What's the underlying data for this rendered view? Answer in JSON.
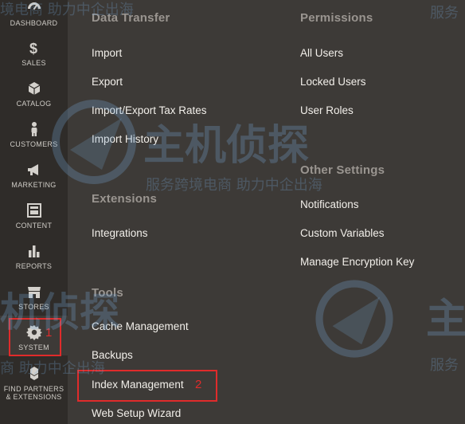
{
  "sidebar": {
    "items": [
      {
        "label": "DASHBOARD",
        "icon": "dashboard-icon"
      },
      {
        "label": "SALES",
        "icon": "dollar-icon"
      },
      {
        "label": "CATALOG",
        "icon": "box-icon"
      },
      {
        "label": "CUSTOMERS",
        "icon": "person-icon"
      },
      {
        "label": "MARKETING",
        "icon": "megaphone-icon"
      },
      {
        "label": "CONTENT",
        "icon": "layout-icon"
      },
      {
        "label": "REPORTS",
        "icon": "bar-chart-icon"
      },
      {
        "label": "STORES",
        "icon": "store-icon"
      },
      {
        "label": "SYSTEM",
        "icon": "gear-icon"
      },
      {
        "label": "FIND PARTNERS & EXTENSIONS",
        "icon": "cubes-icon"
      }
    ]
  },
  "annotations": {
    "step1": "1",
    "step2": "2"
  },
  "menu": {
    "data_transfer": {
      "title": "Data Transfer",
      "items": [
        "Import",
        "Export",
        "Import/Export Tax Rates",
        "Import History"
      ]
    },
    "extensions": {
      "title": "Extensions",
      "items": [
        "Integrations"
      ]
    },
    "tools": {
      "title": "Tools",
      "items": [
        "Cache Management",
        "Backups",
        "Index Management",
        "Web Setup Wizard"
      ]
    },
    "permissions": {
      "title": "Permissions",
      "items": [
        "All Users",
        "Locked Users",
        "User Roles"
      ]
    },
    "other_settings": {
      "title": "Other Settings",
      "items": [
        "Notifications",
        "Custom Variables",
        "Manage Encryption Key"
      ]
    }
  },
  "watermark": {
    "brand": "主机侦探",
    "slogan": "服务跨境电商 助力中企出海",
    "top_left": "境电商 助力中企出海",
    "top_right": "服务",
    "bottom_left": "商 助力中企出海",
    "bottom_right": "服务",
    "mid_right": "主",
    "left_brand": "机侦探"
  }
}
